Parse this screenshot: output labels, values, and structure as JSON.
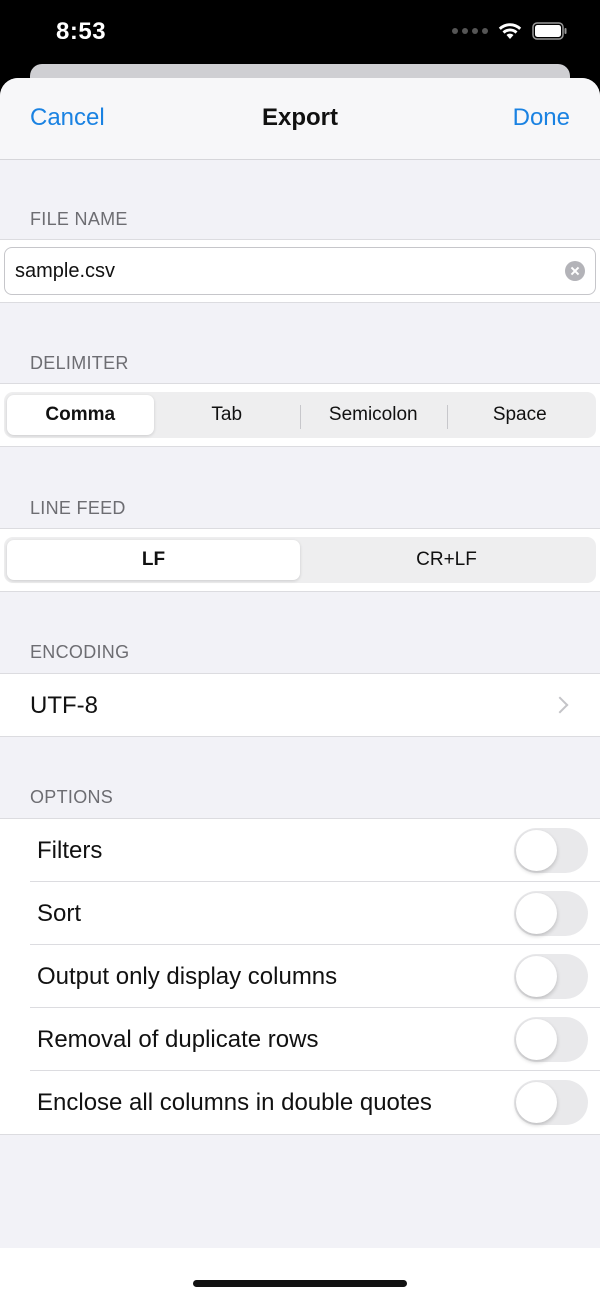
{
  "status": {
    "time": "8:53"
  },
  "nav": {
    "cancel": "Cancel",
    "title": "Export",
    "done": "Done"
  },
  "file_name": {
    "header": "FILE NAME",
    "value": "sample.csv"
  },
  "delimiter": {
    "header": "DELIMITER",
    "options": [
      "Comma",
      "Tab",
      "Semicolon",
      "Space"
    ],
    "selected": "Comma"
  },
  "line_feed": {
    "header": "LINE FEED",
    "options": [
      "LF",
      "CR+LF"
    ],
    "selected": "LF"
  },
  "encoding": {
    "header": "ENCODING",
    "value": "UTF-8"
  },
  "options": {
    "header": "OPTIONS",
    "items": [
      {
        "label": "Filters",
        "on": false
      },
      {
        "label": "Sort",
        "on": false
      },
      {
        "label": "Output only display columns",
        "on": false
      },
      {
        "label": "Removal of duplicate rows",
        "on": false
      },
      {
        "label": "Enclose all columns in double quotes",
        "on": false
      }
    ]
  },
  "colors": {
    "accent": "#1a82e2",
    "background": "#f2f2f7"
  }
}
